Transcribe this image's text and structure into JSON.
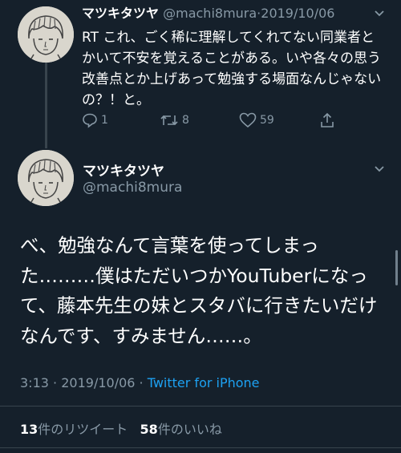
{
  "tweet1": {
    "name": "マツキタツヤ",
    "handle": "@machi8mura",
    "dot": "·",
    "date": "2019/10/06",
    "text": "RT これ、ごく稀に理解してくれてない同業者とかいて不安を覚えることがある。いや各々の思う改善点とか上げあって勉強する場面なんじゃないの？！と。",
    "reply_count": "1",
    "retweet_count": "8",
    "like_count": "59"
  },
  "tweet2": {
    "name": "マツキタツヤ",
    "handle": "@machi8mura",
    "text": "べ、勉強なんて言葉を使ってしまった………僕はただいつかYouTuberになって、藤本先生の妹とスタバに行きたいだけなんです、すみません……。",
    "time": "3:13",
    "sep": "·",
    "date": "2019/10/06",
    "source": "Twitter for iPhone",
    "retweets_num": "13",
    "retweets_label": "件のリツイート",
    "likes_num": "58",
    "likes_label": "件のいいね"
  },
  "colors": {
    "background": "#15202b",
    "secondary_text": "#8899a6",
    "accent": "#1da1f2",
    "divider": "#38444d"
  },
  "icons": [
    "avatar-image",
    "reply-icon",
    "retweet-icon",
    "like-icon",
    "share-icon",
    "chevron-down-icon"
  ]
}
